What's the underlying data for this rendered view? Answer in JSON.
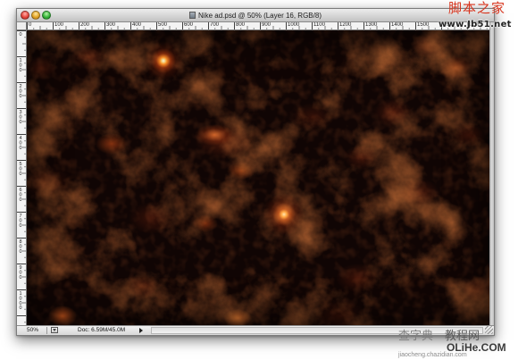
{
  "window": {
    "title": "Nike ad.psd @ 50% (Layer 16, RGB/8)",
    "controls": [
      "close-button",
      "minimize-button",
      "zoom-button"
    ],
    "proxy_icon": "psd-document-icon"
  },
  "rulers": {
    "top": {
      "labels": [
        "0",
        "100",
        "200",
        "300",
        "400",
        "500",
        "600",
        "700",
        "800",
        "900",
        "1000",
        "1100",
        "1200",
        "1300",
        "1400",
        "1500",
        "1600",
        "1700"
      ]
    },
    "left": {
      "labels": [
        "0",
        "100",
        "200",
        "300",
        "400",
        "500",
        "600",
        "700",
        "800",
        "900",
        "1000"
      ]
    }
  },
  "status_bar": {
    "zoom": "50%",
    "doc_info": "Doc: 6.59M/45.0M",
    "menu_icon": "triangle-right-icon"
  },
  "colors": {
    "canvas_base": "#100504",
    "glow_orange": "#ff8a22",
    "glow_hot": "#fffbe6",
    "window_chrome": "#cdcdcd",
    "watermark_red": "#d8361f"
  },
  "watermarks": {
    "jb51": {
      "logo": "脚本之家",
      "url": "www.Jb51.net"
    },
    "chazidian": {
      "logo_left": "查字典",
      "logo_right": "教程网",
      "url": "jiaocheng.chazidian.com"
    },
    "olihe": {
      "url": "OLiHe.COM"
    }
  }
}
